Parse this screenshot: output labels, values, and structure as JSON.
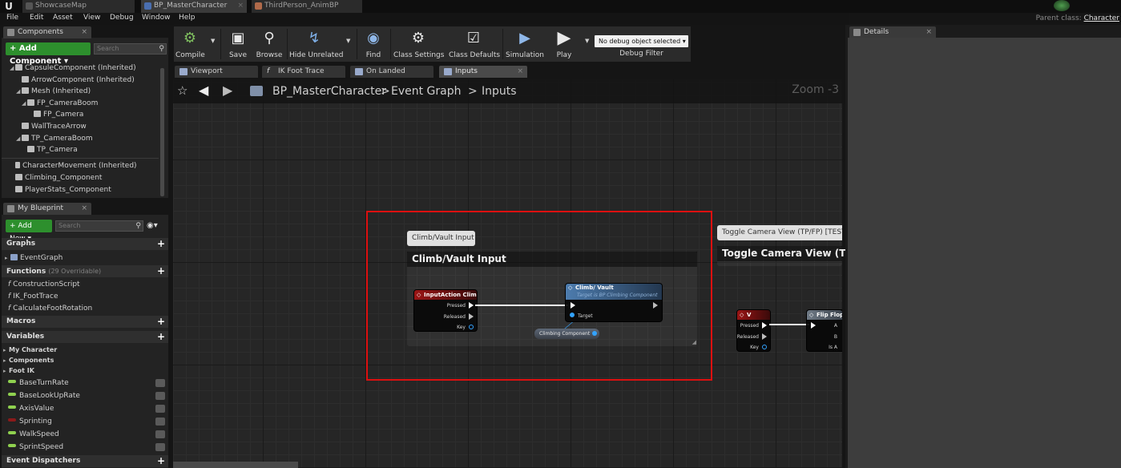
{
  "titlebar": {
    "tabs": [
      {
        "label": "ShowcaseMap",
        "active": false
      },
      {
        "label": "BP_MasterCharacter",
        "active": true
      },
      {
        "label": "ThirdPerson_AnimBP",
        "active": false
      }
    ],
    "parent_class_label": "Parent class:",
    "parent_class_value": "Character"
  },
  "menu": [
    "File",
    "Edit",
    "Asset",
    "View",
    "Debug",
    "Window",
    "Help"
  ],
  "components": {
    "tab_label": "Components",
    "add_label": "+ Add Component ▾",
    "search_placeholder": "Search",
    "items": [
      "CapsuleComponent (Inherited)",
      "ArrowComponent (Inherited)",
      "Mesh (Inherited)",
      "FP_CameraBoom",
      "FP_Camera",
      "WallTraceArrow",
      "TP_CameraBoom",
      "TP_Camera",
      "CharacterMovement (Inherited)",
      "Climbing_Component",
      "PlayerStats_Component"
    ]
  },
  "my_blueprint": {
    "tab_label": "My Blueprint",
    "add_label": "+ Add New ▾",
    "search_placeholder": "Search",
    "graphs_label": "Graphs",
    "graphs": [
      "EventGraph"
    ],
    "functions_label": "Functions",
    "functions_sub": "(29 Overridable)",
    "functions": [
      "ConstructionScript",
      "IK_FootTrace",
      "CalculateFootRotation"
    ],
    "macros_label": "Macros",
    "variables_label": "Variables",
    "categories": [
      "My Character",
      "Components",
      "Foot IK"
    ],
    "variables": [
      {
        "name": "BaseTurnRate",
        "color": "#8fd14f"
      },
      {
        "name": "BaseLookUpRate",
        "color": "#8fd14f"
      },
      {
        "name": "AxisValue",
        "color": "#8fd14f"
      },
      {
        "name": "Sprinting",
        "color": "#8b1a1a"
      },
      {
        "name": "WalkSpeed",
        "color": "#8fd14f"
      },
      {
        "name": "SprintSpeed",
        "color": "#8fd14f"
      }
    ],
    "dispatchers_label": "Event Dispatchers"
  },
  "toolbar": {
    "buttons": [
      "Compile",
      "Save",
      "Browse",
      "Hide Unrelated",
      "Find",
      "Class Settings",
      "Class Defaults",
      "Simulation",
      "Play"
    ],
    "debug_select": "No debug object selected ▾",
    "debug_label": "Debug Filter"
  },
  "editor_tabs": [
    "Viewport",
    "IK Foot Trace",
    "On Landed",
    "Inputs"
  ],
  "breadcrumb": {
    "blueprint": "BP_MasterCharacter",
    "sep1": ">",
    "graph": "Event Graph",
    "sep2": ">",
    "collapsed": "Inputs",
    "zoom": "Zoom -3"
  },
  "graph": {
    "comment_bubble_1": "Climb/Vault Input",
    "comment_title_1": "Climb/Vault Input",
    "comment_bubble_2": "Toggle Camera View (TP/FP) [TESTING]",
    "comment_title_2": "Toggle Camera View (TP/FP)",
    "input_node": {
      "title": "InputAction Climb",
      "pins": [
        "Pressed",
        "Released",
        "Key"
      ]
    },
    "call_node": {
      "title": "Climb/ Vault",
      "subtitle": "Target is BP Climbing Component",
      "pin": "Target"
    },
    "ref_node": "Climbing Component",
    "key_node": {
      "title": "V",
      "pins": [
        "Pressed",
        "Released",
        "Key"
      ]
    },
    "flipflop_node": {
      "title": "Flip Flop",
      "pins": [
        "A",
        "B",
        "Is A"
      ]
    }
  },
  "details": {
    "tab_label": "Details"
  }
}
